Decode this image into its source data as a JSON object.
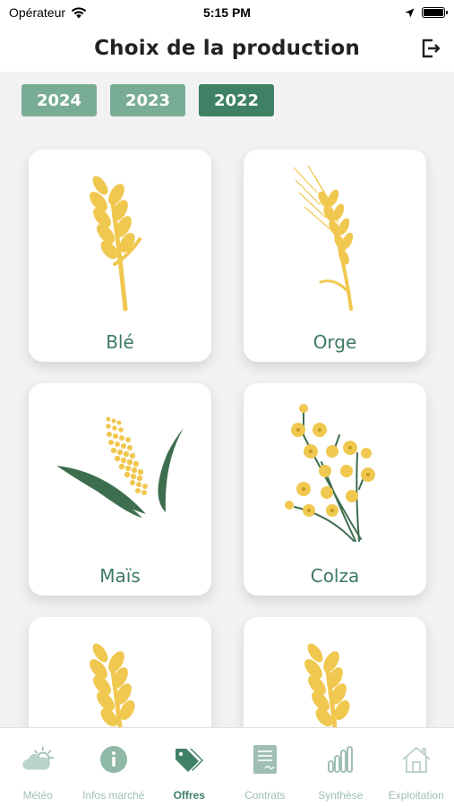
{
  "status_bar": {
    "carrier": "Opérateur",
    "time": "5:15 PM"
  },
  "header": {
    "title": "Choix de la production",
    "logout_icon": "logout-icon"
  },
  "year_tabs": [
    {
      "label": "2024",
      "active": false
    },
    {
      "label": "2023",
      "active": false
    },
    {
      "label": "2022",
      "active": true
    }
  ],
  "crops": [
    {
      "label": "Blé",
      "icon": "wheat-icon"
    },
    {
      "label": "Orge",
      "icon": "barley-icon"
    },
    {
      "label": "Maïs",
      "icon": "corn-icon"
    },
    {
      "label": "Colza",
      "icon": "rapeseed-icon"
    },
    {
      "label": "",
      "icon": "wheat-icon"
    },
    {
      "label": "",
      "icon": "wheat-icon"
    }
  ],
  "tab_bar": [
    {
      "label": "Météo",
      "icon": "weather-icon",
      "active": false
    },
    {
      "label": "Infos marché",
      "icon": "info-icon",
      "active": false
    },
    {
      "label": "Offres",
      "icon": "tags-icon",
      "active": true
    },
    {
      "label": "Contrats",
      "icon": "contract-icon",
      "active": false
    },
    {
      "label": "Synthèse",
      "icon": "bar-chart-icon",
      "active": false
    },
    {
      "label": "Exploitation",
      "icon": "home-icon",
      "active": false
    }
  ],
  "colors": {
    "primary": "#3e8165",
    "tab_inactive": "#79ac95",
    "crop_yellow": "#f0c850",
    "leaf_green": "#3d6e4e",
    "label_green": "#3e7a60"
  }
}
